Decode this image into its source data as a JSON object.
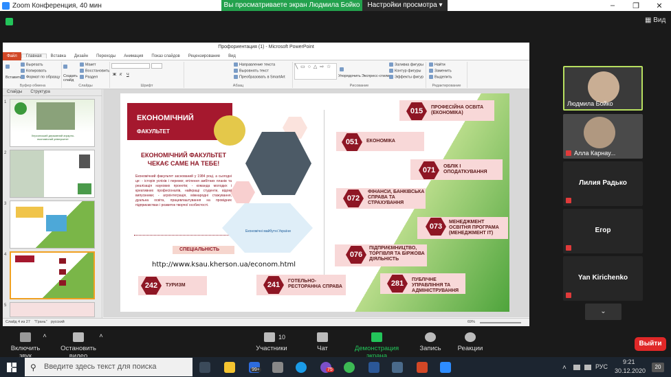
{
  "zoom": {
    "window_title": "Zoom Конференция, 40 мин",
    "share_banner": "Вы просматриваете экран Людмила Бойко",
    "view_options": "Настройки просмотра",
    "view_button": "Вид",
    "toolbar": {
      "mute": "Включить звук",
      "video": "Остановить видео",
      "participants": "Участники",
      "participants_count": "10",
      "chat": "Чат",
      "share": "Демонстрация экрана",
      "record": "Запись",
      "reactions": "Реакции",
      "leave": "Выйти"
    },
    "participants": [
      {
        "name": "Людмила Бойко"
      },
      {
        "name": "Алла Карнау..."
      },
      {
        "name": "Лилия Радько"
      },
      {
        "name": "Егор"
      },
      {
        "name": "Yan Kirichenko"
      }
    ]
  },
  "ppt": {
    "title": "Профориентация (1) - Microsoft PowerPoint",
    "tabs": [
      "Файл",
      "Главная",
      "Вставка",
      "Дизайн",
      "Переходы",
      "Анимация",
      "Показ слайдов",
      "Рецензирование",
      "Вид"
    ],
    "ribbon": {
      "paste": "Вставить",
      "cut": "Вырезать",
      "copy": "Копировать",
      "format_painter": "Формат по образцу",
      "clipboard_label": "Буфер обмена",
      "new_slide": "Создать слайд",
      "layout": "Макет",
      "reset": "Восстановить",
      "section": "Раздел",
      "slides_label": "Слайды",
      "font_label": "Шрифт",
      "paragraph_label": "Абзац",
      "text_direction": "Направление текста",
      "align_text": "Выровнять текст",
      "smartart": "Преобразовать в SmartArt",
      "arrange": "Упорядочить",
      "quick_styles": "Экспресс-стили",
      "shape_fill": "Заливка фигуры",
      "shape_outline": "Контур фигуры",
      "shape_effects": "Эффекты фигур",
      "drawing_label": "Рисование",
      "find": "Найти",
      "replace": "Заменить",
      "select": "Выделить",
      "editing_label": "Редактирование"
    },
    "panel_tabs": [
      "Слайды",
      "Структура"
    ],
    "thumb_captions": {
      "slide1": "Херсонський державний аграрно-економічний університет"
    },
    "status": {
      "slide": "Слайд 4 из 27",
      "theme": "\"Грань\"",
      "lang": "русский",
      "zoom": "69%"
    }
  },
  "slide": {
    "title": "ЕКОНОМІЧНИЙ",
    "subtitle": "ФАКУЛЬТЕТ",
    "headline": "ЕКОНОМІЧНИЙ ФАКУЛЬТЕТ ЧЕКАЄ САМЕ НА ТЕБЕ!",
    "body": "Економічний факультет заснований у 1984 році, а сьогодні це: - історія успіхів і перемог, втілення амбітних планів та реалізація наукових проектів; - команда молодих і креативних професіоналів, найкращі студенти, відомі випускники; - агроінтеграція, міжнародні стажування, дуальна освіта, працевлаштування на провідних підприємствах і розвиток творчої особистості.",
    "specialty_label": "СПЕЦІАЛЬНІСТЬ",
    "url": "http://www.ksau.kherson.ua/econom.html",
    "banner_text": "Економічні майбутні України",
    "specialties": [
      {
        "code": "015",
        "label": "ПРОФЕСІЙНА ОСВІТА (ЕКОНОМІКА)"
      },
      {
        "code": "051",
        "label": "ЕКОНОМІКА"
      },
      {
        "code": "071",
        "label": "ОБЛІК І ОПОДАТКУВАННЯ"
      },
      {
        "code": "072",
        "label": "ФІНАНСИ, БАНКІВСЬКА СПРАВА ТА СТРАХУВАННЯ"
      },
      {
        "code": "073",
        "label": "МЕНЕДЖМЕНТ ОСВІТНЯ ПРОГРАМА (МЕНЕДЖМЕНТ ІТ)"
      },
      {
        "code": "076",
        "label": "ПІДПРИЄМНИЦТВО, ТОРГІВЛЯ ТА БІРЖОВА ДІЯЛЬНІСТЬ"
      },
      {
        "code": "242",
        "label": "ТУРИЗМ"
      },
      {
        "code": "241",
        "label": "ГОТЕЛЬНО- РЕСТОРАННА СПРАВА"
      },
      {
        "code": "281",
        "label": "ПУБЛІЧНЕ УПРАВЛІННЯ ТА АДМІНІСТРУВАННЯ"
      }
    ]
  },
  "taskbar": {
    "search_placeholder": "Введите здесь текст для поиска",
    "badge_99": "99+",
    "badge_75": "75",
    "lang": "РУС",
    "time": "9:21",
    "date": "30.12.2020",
    "notif_count": "20"
  },
  "colors": {
    "accent_red": "#8e1624",
    "share_green": "#23a14d",
    "leave_red": "#e02828",
    "zoom_bg": "#1a1a1a"
  }
}
